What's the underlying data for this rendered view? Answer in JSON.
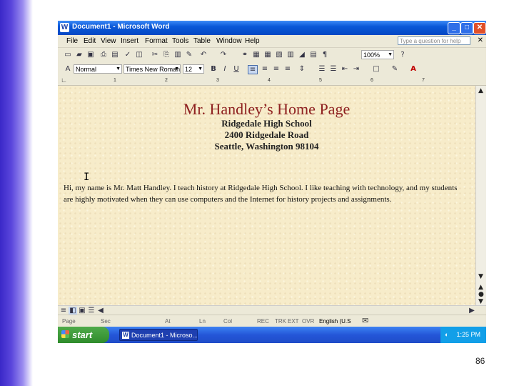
{
  "window": {
    "title": "Document1 - Microsoft Word",
    "controls": {
      "minimize": "_",
      "maximize": "□",
      "close": "✕"
    }
  },
  "menu": {
    "items": [
      "File",
      "Edit",
      "View",
      "Insert",
      "Format",
      "Tools",
      "Table",
      "Window",
      "Help"
    ],
    "ask_placeholder": "Type a question for help",
    "close_glyph": "✕"
  },
  "toolbar_standard": {
    "zoom": "100%"
  },
  "toolbar_formatting": {
    "style": "Normal",
    "font": "Times New Roman",
    "size": "12"
  },
  "ruler": {
    "numbers": [
      "1",
      "2",
      "3",
      "4",
      "5",
      "6",
      "7"
    ]
  },
  "document": {
    "heading": "Mr. Handley’s Home Page",
    "address": [
      "Ridgedale High School",
      "2400 Ridgedale Road",
      "Seattle, Washington 98104"
    ],
    "paragraph_lines": [
      "Hi, my name is Mr. Matt Handley. I teach history at Ridgedale High School. I like teaching with technology, and my students",
      "are highly motivated when they can use computers and the Internet for history projects and assignments."
    ]
  },
  "statusbar": {
    "page": "Page",
    "sec": "Sec",
    "at": "At",
    "ln": "Ln",
    "col": "Col",
    "rec": "REC",
    "trk": "TRK",
    "ext": "EXT",
    "ovr": "OVR",
    "language": "English (U.S"
  },
  "taskbar": {
    "start": "start",
    "task": "Document1 - Microso...",
    "clock": "1:25 PM"
  },
  "slide": {
    "page_number": "86"
  },
  "colors": {
    "title_bar": "#0a58d8",
    "heading": "#8e2020",
    "page_bg": "#f7ecca",
    "slide_bar": "#3a28c8"
  }
}
